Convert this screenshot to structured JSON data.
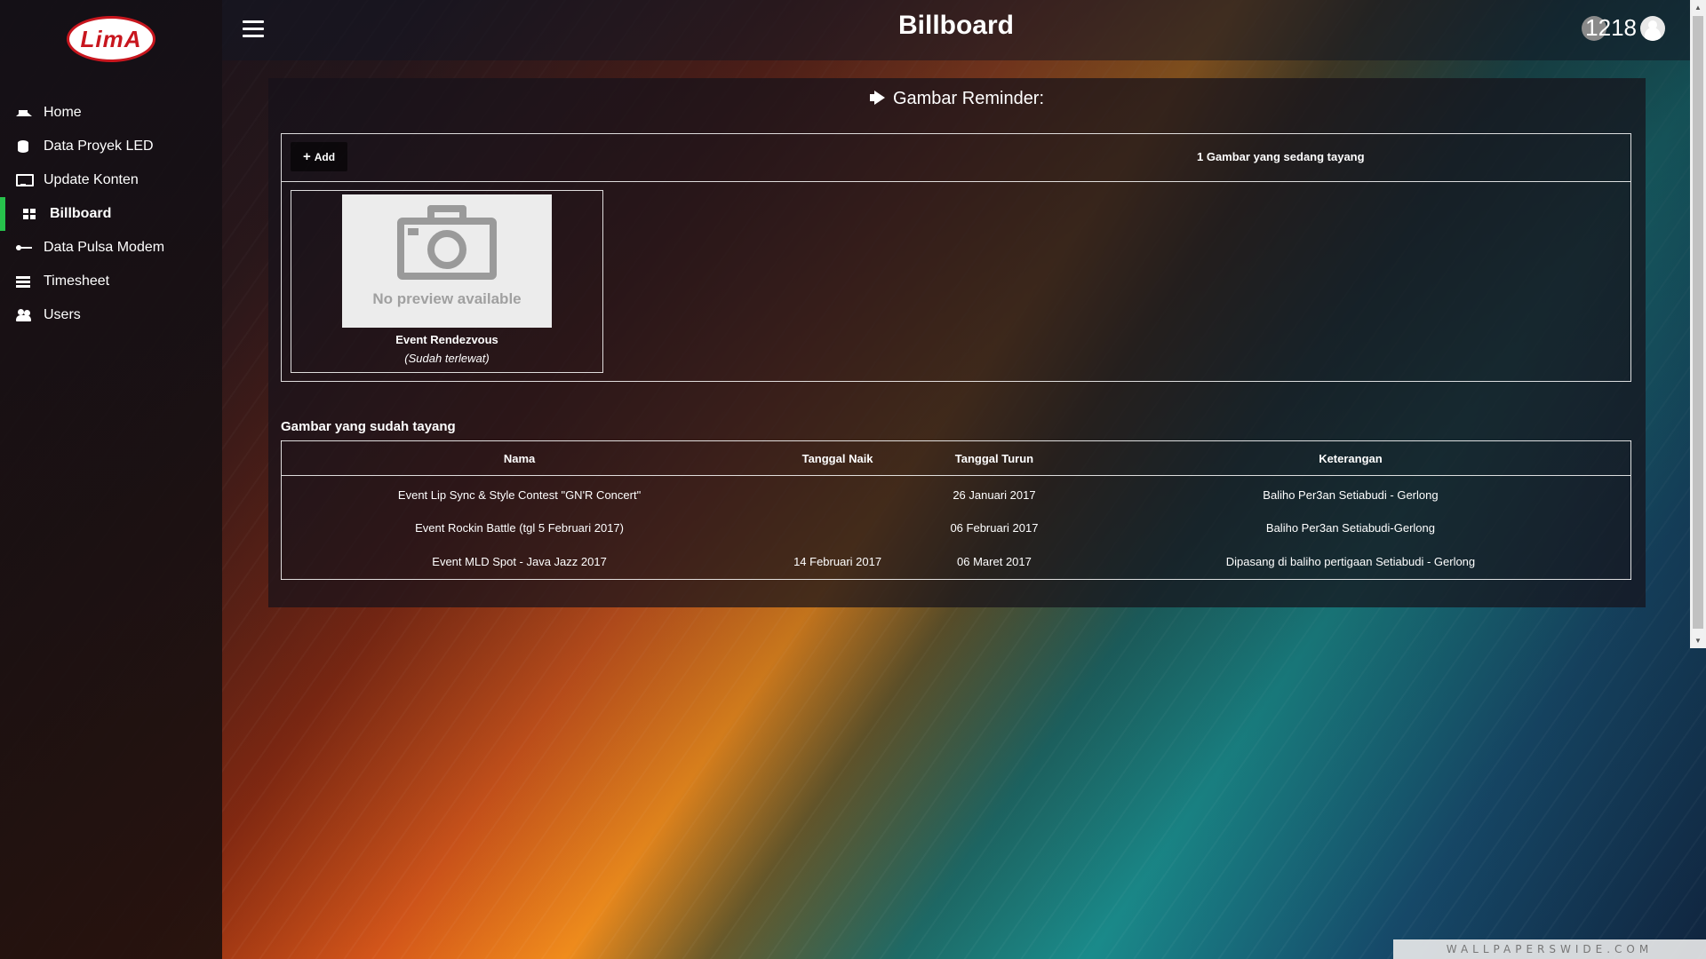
{
  "app": {
    "logo_text": "LimA",
    "page_title": "Billboard"
  },
  "sidebar": {
    "items": [
      {
        "label": "Home",
        "icon": "home-icon",
        "active": false
      },
      {
        "label": "Data Proyek LED",
        "icon": "database-icon",
        "active": false
      },
      {
        "label": "Update Konten",
        "icon": "monitor-icon",
        "active": false
      },
      {
        "label": "Billboard",
        "icon": "grid-icon",
        "active": true
      },
      {
        "label": "Data Pulsa Modem",
        "icon": "usb-icon",
        "active": false
      },
      {
        "label": "Timesheet",
        "icon": "list-icon",
        "active": false
      },
      {
        "label": "Users",
        "icon": "users-icon",
        "active": false
      }
    ],
    "active_color": "#27c24c"
  },
  "header": {
    "user_id": "1218"
  },
  "reminder": {
    "title": "Gambar Reminder:",
    "add_label": "Add",
    "showing_count": "1 Gambar yang sedang tayang",
    "cards": [
      {
        "no_preview": "No preview available",
        "title": "Event Rendezvous",
        "status": "Sudah terlewat"
      }
    ]
  },
  "past": {
    "heading": "Gambar yang sudah tayang",
    "columns": [
      "Nama",
      "Tanggal Naik",
      "Tanggal Turun",
      "Keterangan"
    ],
    "rows": [
      [
        "Event Lip Sync & Style Contest \"GN'R Concert\"",
        "",
        "26 Januari 2017",
        "Baliho Per3an Setiabudi - Gerlong"
      ],
      [
        "Event Rockin Battle (tgl 5 Februari 2017)",
        "",
        "06 Februari 2017",
        "Baliho Per3an Setiabudi-Gerlong"
      ],
      [
        "Event MLD Spot - Java Jazz 2017",
        "14 Februari 2017",
        "06 Maret 2017",
        "Dipasang di baliho pertigaan Setiabudi - Gerlong"
      ]
    ]
  },
  "watermark": "WALLPAPERSWIDE.COM"
}
